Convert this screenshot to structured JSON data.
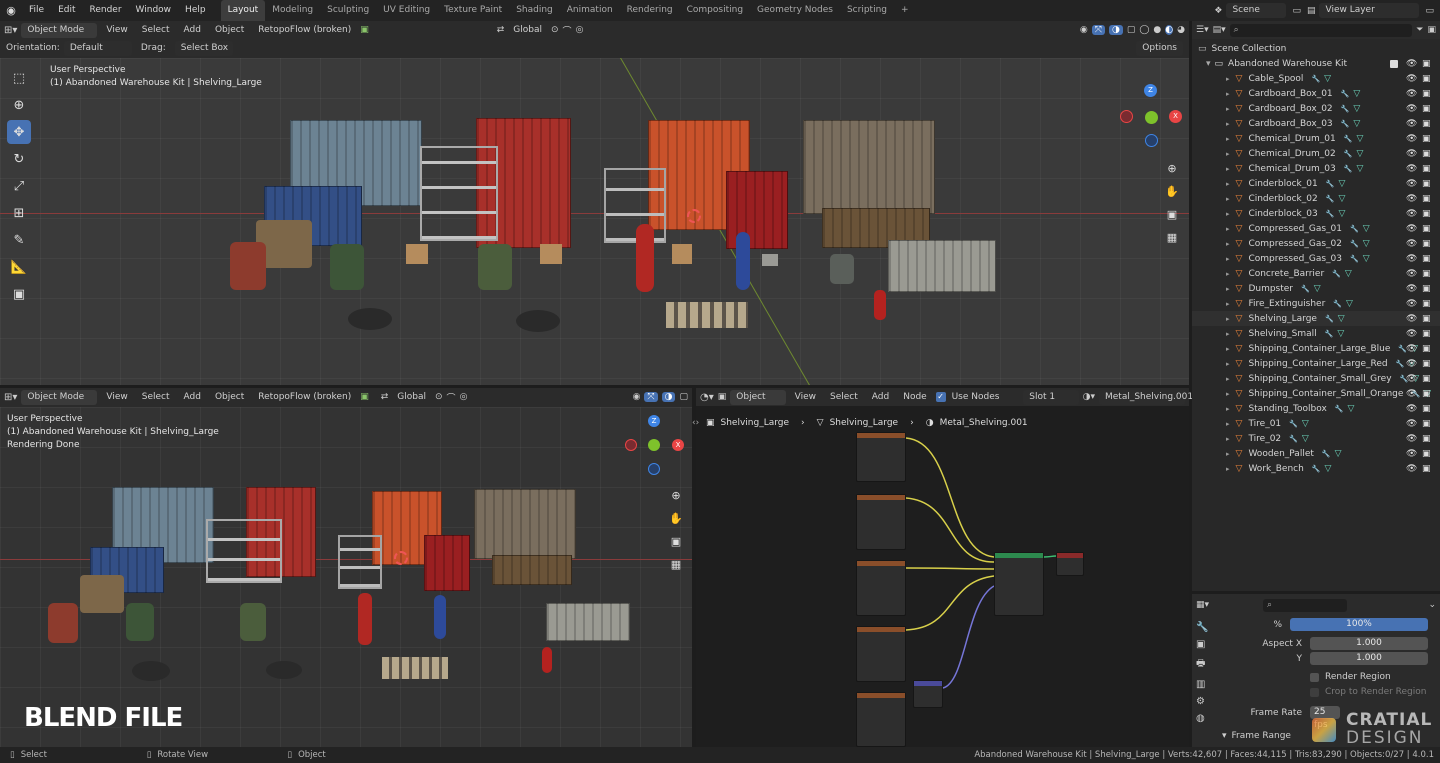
{
  "topbar": {
    "menus": [
      "File",
      "Edit",
      "Render",
      "Window",
      "Help"
    ],
    "workspaces": [
      "Layout",
      "Modeling",
      "Sculpting",
      "UV Editing",
      "Texture Paint",
      "Shading",
      "Animation",
      "Rendering",
      "Compositing",
      "Geometry Nodes",
      "Scripting"
    ],
    "active_workspace": "Layout",
    "add_tab": "+",
    "scene": "Scene",
    "view_layer": "View Layer"
  },
  "viewport_top": {
    "mode": "Object Mode",
    "menus": [
      "View",
      "Select",
      "Add",
      "Object"
    ],
    "addon": "RetopoFlow (broken)",
    "transform_space": "Global",
    "orientation_label": "Orientation:",
    "orientation_value": "Default",
    "drag_label": "Drag:",
    "drag_value": "Select Box",
    "options": "Options",
    "overlay_line1": "User Perspective",
    "overlay_line2": "(1) Abandoned Warehouse Kit | Shelving_Large"
  },
  "viewport_bottom": {
    "mode": "Object Mode",
    "menus": [
      "View",
      "Select",
      "Add",
      "Object"
    ],
    "addon": "RetopoFlow (broken)",
    "transform_space": "Global",
    "overlay_line1": "User Perspective",
    "overlay_line2": "(1) Abandoned Warehouse Kit | Shelving_Large",
    "overlay_line3": "Rendering Done",
    "watermark": "BLEND FILE"
  },
  "node_editor": {
    "type": "Object",
    "menus": [
      "View",
      "Select",
      "Add",
      "Node"
    ],
    "use_nodes": "Use Nodes",
    "slot": "Slot 1",
    "material": "Metal_Shelving.001",
    "breadcrumb": [
      "Shelving_Large",
      "Shelving_Large",
      "Metal_Shelving.001"
    ]
  },
  "outliner": {
    "root": "Scene Collection",
    "collection": "Abandoned Warehouse Kit",
    "items": [
      "Cable_Spool",
      "Cardboard_Box_01",
      "Cardboard_Box_02",
      "Cardboard_Box_03",
      "Chemical_Drum_01",
      "Chemical_Drum_02",
      "Chemical_Drum_03",
      "Cinderblock_01",
      "Cinderblock_02",
      "Cinderblock_03",
      "Compressed_Gas_01",
      "Compressed_Gas_02",
      "Compressed_Gas_03",
      "Concrete_Barrier",
      "Dumpster",
      "Fire_Extinguisher",
      "Shelving_Large",
      "Shelving_Small",
      "Shipping_Container_Large_Blue",
      "Shipping_Container_Large_Red",
      "Shipping_Container_Small_Grey",
      "Shipping_Container_Small_Orange",
      "Standing_Toolbox",
      "Tire_01",
      "Tire_02",
      "Wooden_Pallet",
      "Work_Bench"
    ],
    "selected": "Shelving_Large"
  },
  "properties": {
    "percent_label": "%",
    "percent_value": "100%",
    "aspect_x_label": "Aspect X",
    "aspect_x_value": "1.000",
    "y_label": "Y",
    "y_value": "1.000",
    "render_region": "Render Region",
    "crop_region": "Crop to Render Region",
    "frame_rate_label": "Frame Rate",
    "frame_rate_value": "25 fps",
    "frame_range": "Frame Range"
  },
  "brand": {
    "line1": "CRATIAL",
    "line2": "DESIGN"
  },
  "statusbar": {
    "select": "Select",
    "rotate": "Rotate View",
    "object": "Object",
    "info": "Abandoned Warehouse Kit | Shelving_Large | Verts:42,607 | Faces:44,115 | Tris:83,290 | Objects:0/27 | 4.0.1"
  },
  "colors": {
    "accent": "#4772b3",
    "axis_x": "#e94545",
    "axis_y": "#7ec22b",
    "axis_z": "#3f85e6",
    "mesh_icon": "#e8833a",
    "modifier_icon": "#4aa3e8",
    "material_icon": "#6ad0b8"
  }
}
